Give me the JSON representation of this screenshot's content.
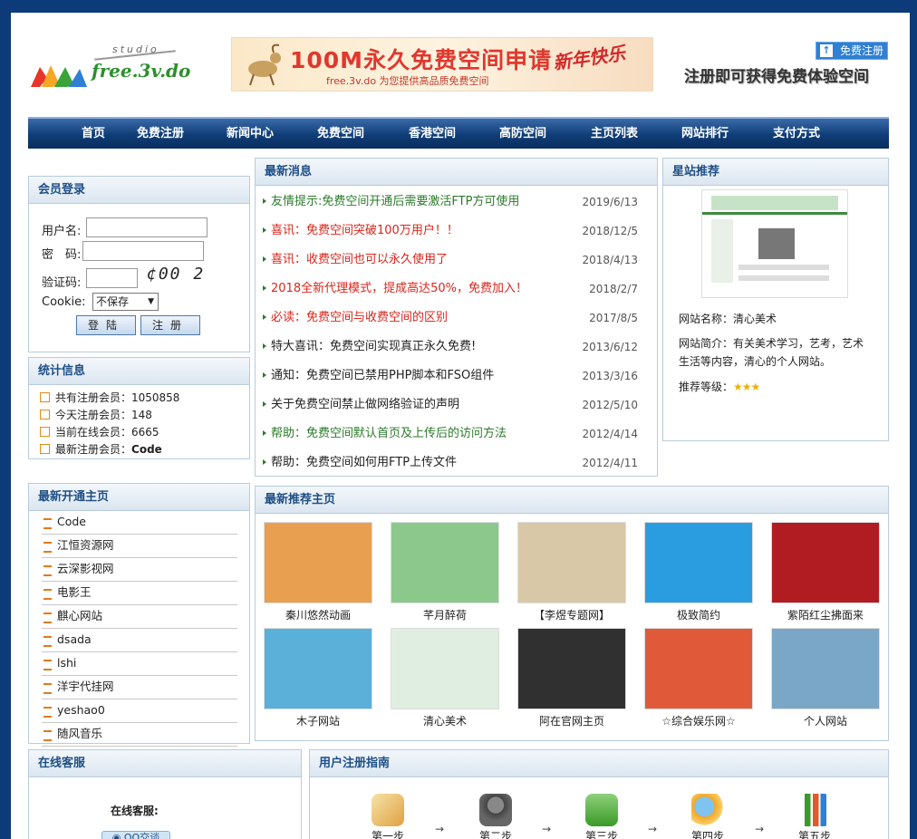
{
  "header": {
    "logo_studio": "studio",
    "logo_name": "free.3v.do",
    "banner_title": "100M永久免费空间申请",
    "banner_sub": "free.3v.do 为您提供高品质免费空间",
    "banner_newyear": "新年快乐",
    "register_button": "免费注册",
    "register_text": "注册即可获得免费体验空间"
  },
  "nav": [
    "首页",
    "免费注册",
    "新闻中心",
    "免费空间",
    "香港空间",
    "高防空间",
    "主页列表",
    "网站排行",
    "支付方式"
  ],
  "login": {
    "title": "会员登录",
    "username_label": "用户名:",
    "password_label": "密　码:",
    "captcha_label": "验证码:",
    "captcha_value": "¢00 2",
    "cookie_label": "Cookie:",
    "cookie_value": "不保存",
    "login_button": "登陆",
    "register_button": "注册"
  },
  "stats": {
    "title": "统计信息",
    "items": [
      "共有注册会员：1050858",
      "今天注册会员：148",
      "当前在线会员：6665"
    ],
    "latest_label": "最新注册会员：",
    "latest_value": "Code"
  },
  "news": {
    "title": "最新消息",
    "items": [
      {
        "text": "友情提示:免费空间开通后需要激活FTP方可使用",
        "date": "2019/6/13",
        "color": "green"
      },
      {
        "text": "喜讯：免费空间突破100万用户！！",
        "date": "2018/12/5",
        "color": "red"
      },
      {
        "text": "喜讯：收费空间也可以永久使用了",
        "date": "2018/4/13",
        "color": "red"
      },
      {
        "text": "2018全新代理模式，提成高达50%，免费加入！",
        "date": "2018/2/7",
        "color": "red"
      },
      {
        "text": "必读：免费空间与收费空间的区别",
        "date": "2017/8/5",
        "color": "red"
      },
      {
        "text": "特大喜讯：免费空间实现真正永久免费!",
        "date": "2013/6/12",
        "color": "black"
      },
      {
        "text": "通知：免费空间已禁用PHP脚本和FSO组件",
        "date": "2013/3/16",
        "color": "black"
      },
      {
        "text": "关于免费空间禁止做网络验证的声明",
        "date": "2012/5/10",
        "color": "black"
      },
      {
        "text": "帮助：免费空间默认首页及上传后的访问方法",
        "date": "2012/4/14",
        "color": "green"
      },
      {
        "text": "帮助：免费空间如何用FTP上传文件",
        "date": "2012/4/11",
        "color": "black"
      }
    ]
  },
  "star": {
    "title": "星站推荐",
    "name_label": "网站名称：",
    "name_value": "清心美术",
    "intro_label": "网站简介：",
    "intro_value": "有关美术学习，艺考，艺术生活等内容，清心的个人网站。",
    "rating_label": "推荐等级：",
    "rating": 3
  },
  "new_homepages": {
    "title": "最新开通主页",
    "items": [
      "Code",
      "江恒资源网",
      "云深影视网",
      "电影王",
      "麒心网站",
      "dsada",
      "lshi",
      "洋宇代挂网",
      "yeshao0",
      "随风音乐"
    ]
  },
  "recommended": {
    "title": "最新推荐主页",
    "items": [
      {
        "name": "秦川悠然动画",
        "color": "#e8a050"
      },
      {
        "name": "芊月醉荷",
        "color": "#8cc88c"
      },
      {
        "name": "【李煜专题网】",
        "color": "#d8c8a8"
      },
      {
        "name": "极致简约",
        "color": "#2a9de0"
      },
      {
        "name": "紫陌红尘拂面来",
        "color": "#b01c22"
      },
      {
        "name": "木子网站",
        "color": "#5ab0d8"
      },
      {
        "name": "清心美术",
        "color": "#dfeee0"
      },
      {
        "name": "阿在官网主页",
        "color": "#303030"
      },
      {
        "name": "☆综合娱乐网☆",
        "color": "#e05a3a"
      },
      {
        "name": "个人网站",
        "color": "#7aa6c8"
      }
    ]
  },
  "service": {
    "title": "在线客服",
    "label": "在线客服:",
    "qq_button": "QQ交谈"
  },
  "guide": {
    "title": "用户注册指南",
    "steps": [
      "第一步",
      "第二步",
      "第三步",
      "第四步",
      "第五步"
    ]
  }
}
